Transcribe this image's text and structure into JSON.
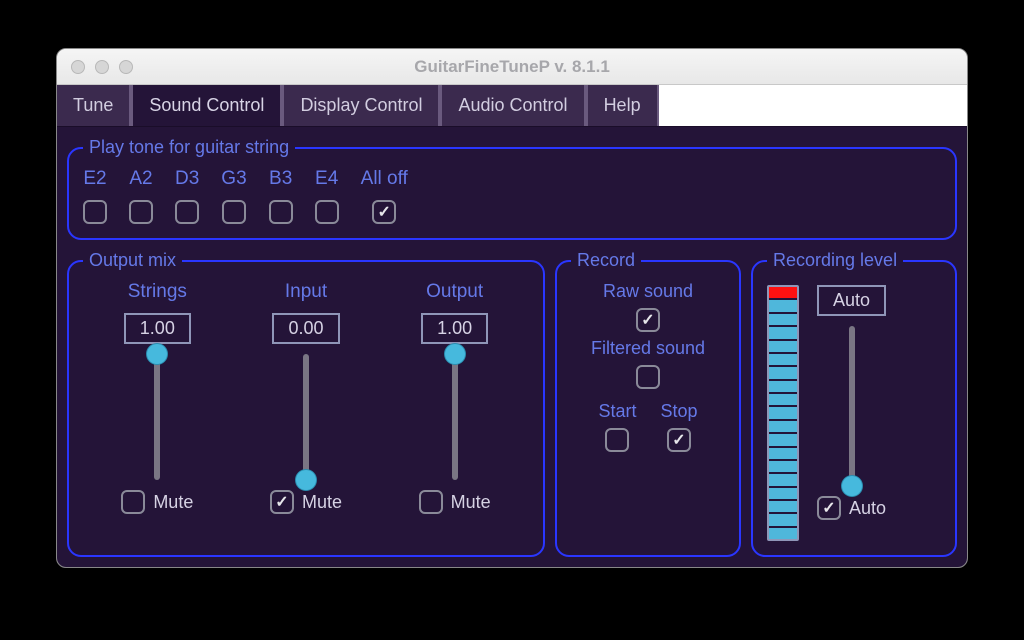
{
  "title": "GuitarFineTuneP v. 8.1.1",
  "tabs": [
    {
      "label": "Tune",
      "active": false
    },
    {
      "label": "Sound Control",
      "active": true
    },
    {
      "label": "Display Control",
      "active": false
    },
    {
      "label": "Audio Control",
      "active": false
    },
    {
      "label": "Help",
      "active": false
    }
  ],
  "tone": {
    "legend": "Play tone for guitar string",
    "items": [
      {
        "label": "E2",
        "checked": false
      },
      {
        "label": "A2",
        "checked": false
      },
      {
        "label": "D3",
        "checked": false
      },
      {
        "label": "G3",
        "checked": false
      },
      {
        "label": "B3",
        "checked": false
      },
      {
        "label": "E4",
        "checked": false
      },
      {
        "label": "All off",
        "checked": true
      }
    ]
  },
  "mix": {
    "legend": "Output mix",
    "mute_label": "Mute",
    "cols": [
      {
        "title": "Strings",
        "value": "1.00",
        "pos": 1.0,
        "mute": false
      },
      {
        "title": "Input",
        "value": "0.00",
        "pos": 0.0,
        "mute": true
      },
      {
        "title": "Output",
        "value": "1.00",
        "pos": 1.0,
        "mute": false
      }
    ]
  },
  "record": {
    "legend": "Record",
    "raw_label": "Raw sound",
    "raw_checked": true,
    "filtered_label": "Filtered sound",
    "filtered_checked": false,
    "start_label": "Start",
    "start_checked": false,
    "stop_label": "Stop",
    "stop_checked": true
  },
  "level": {
    "legend": "Recording level",
    "auto_label": "Auto",
    "auto_box": "Auto",
    "auto_checked": true,
    "slider_pos": 0.0,
    "meter_segments": 19,
    "meter_lit": 19,
    "meter_red": 1
  }
}
